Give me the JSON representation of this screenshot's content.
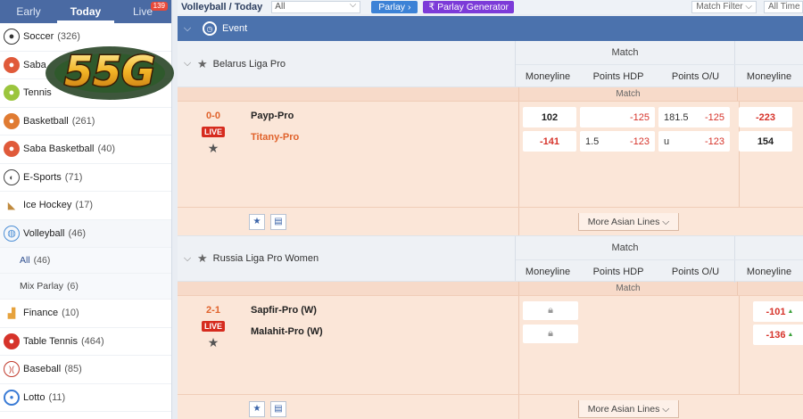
{
  "sidebar": {
    "tabs": [
      {
        "label": "Early"
      },
      {
        "label": "Today"
      },
      {
        "label": "Live",
        "badge": "139"
      }
    ],
    "sports": [
      {
        "label": "Soccer",
        "count": "(326)",
        "icon": "soccer-icon",
        "color": "#333"
      },
      {
        "label": "Saba",
        "count": "",
        "icon": "saba-icon",
        "color": "#e05a3a"
      },
      {
        "label": "Tennis",
        "count": "",
        "icon": "tennis-icon",
        "color": "#9bc53d"
      },
      {
        "label": "Basketball",
        "count": "(261)",
        "icon": "basketball-icon",
        "color": "#e07b32"
      },
      {
        "label": "Saba Basketball",
        "count": "(40)",
        "icon": "saba-basketball-icon",
        "color": "#e05a3a"
      },
      {
        "label": "E-Sports",
        "count": "(71)",
        "icon": "esports-icon",
        "color": "#444"
      },
      {
        "label": "Ice Hockey",
        "count": "(17)",
        "icon": "ice-hockey-icon",
        "color": "#c08a3e"
      },
      {
        "label": "Volleyball",
        "count": "(46)",
        "icon": "volleyball-icon",
        "color": "#4d8fd6"
      }
    ],
    "volleyball_sub": [
      {
        "label": "All",
        "count": "(46)"
      },
      {
        "label": "Mix Parlay",
        "count": "(6)"
      }
    ],
    "more_sports": [
      {
        "label": "Finance",
        "count": "(10)",
        "icon": "finance-icon",
        "color": "#e6a23c"
      },
      {
        "label": "Table Tennis",
        "count": "(464)",
        "icon": "table-tennis-icon",
        "color": "#d6332a"
      },
      {
        "label": "Baseball",
        "count": "(85)",
        "icon": "baseball-icon",
        "color": "#c0392b"
      },
      {
        "label": "Lotto",
        "count": "(11)",
        "icon": "lotto-icon",
        "color": "#3a7bd5"
      }
    ]
  },
  "logo": {
    "text": "55G"
  },
  "topbar": {
    "title": "Volleyball / Today",
    "select_value": "All",
    "parlay_label": "Parlay",
    "parlay_gen_label": "Parlay Generator",
    "match_filter": "Match Filter",
    "all_time": "All Time"
  },
  "event_bar": {
    "label": "Event"
  },
  "headers": {
    "match_group": "Match",
    "moneyline": "Moneyline",
    "points_hdp": "Points HDP",
    "points_ou": "Points O/U",
    "match_sub": "Match",
    "more_lines": "More Asian Lines"
  },
  "leagues": [
    {
      "name": "Belarus Liga Pro",
      "match": {
        "score": "0-0",
        "live": "LIVE",
        "home": "Payp-Pro",
        "away": "Titany-Pro",
        "home_ml": "102",
        "away_ml": "-141",
        "home_hdp_line": "",
        "home_hdp_odds": "-125",
        "away_hdp_line": "1.5",
        "away_hdp_odds": "-123",
        "over_line": "181.5",
        "over_odds": "-125",
        "under_line": "u",
        "under_odds": "-123",
        "home_ml2": "-223",
        "away_ml2": "154"
      }
    },
    {
      "name": "Russia Liga Pro Women",
      "match": {
        "score": "2-1",
        "live": "LIVE",
        "home": "Sapfir-Pro (W)",
        "away": "Malahit-Pro (W)",
        "home_ml2": "-101",
        "away_ml2": "-136"
      }
    }
  ]
}
